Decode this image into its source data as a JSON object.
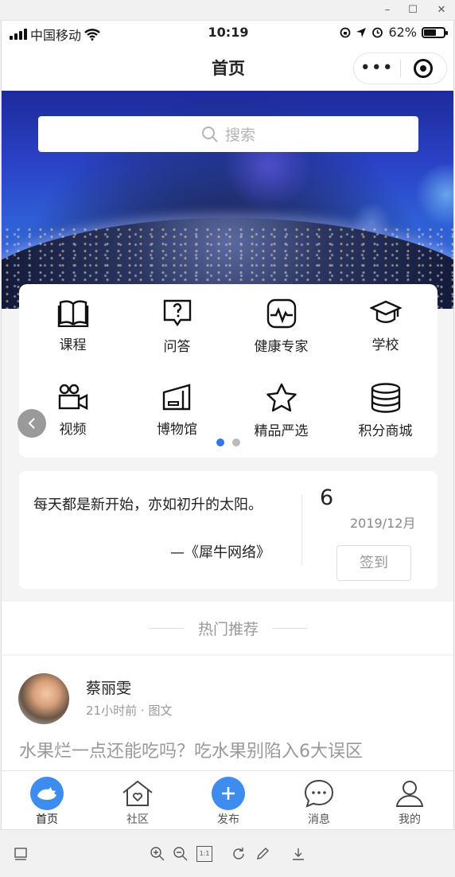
{
  "window": {
    "minimize": "–",
    "maximize": "☐",
    "close": "✕"
  },
  "status": {
    "carrier": "中国移动",
    "time": "10:19",
    "battery_pct": "62%",
    "battery_level": 0.62
  },
  "navbar": {
    "title": "首页"
  },
  "search": {
    "placeholder": "搜索"
  },
  "grid": [
    {
      "label": "课程",
      "icon": "book-icon"
    },
    {
      "label": "问答",
      "icon": "question-icon"
    },
    {
      "label": "健康专家",
      "icon": "health-icon"
    },
    {
      "label": "学校",
      "icon": "graduation-cap-icon"
    },
    {
      "label": "视频",
      "icon": "video-camera-icon"
    },
    {
      "label": "博物馆",
      "icon": "museum-icon"
    },
    {
      "label": "精品严选",
      "icon": "star-icon"
    },
    {
      "label": "积分商城",
      "icon": "coins-icon"
    }
  ],
  "carousel": {
    "pages": 2,
    "active": 0
  },
  "signin": {
    "quote": "每天都是新开始，亦如初升的太阳。",
    "source": "—《犀牛网络》",
    "day": "6",
    "year_month": "2019/12月",
    "button": "签到"
  },
  "recommend": {
    "heading": "热门推荐"
  },
  "post": {
    "author": "蔡丽雯",
    "time": "21小时前",
    "dot": "·",
    "kind": "图文",
    "title": "水果烂一点还能吃吗？吃水果别陷入6大误区"
  },
  "tabs": [
    {
      "label": "首页",
      "icon": "rhino-icon",
      "active": true
    },
    {
      "label": "社区",
      "icon": "house-heart-icon"
    },
    {
      "label": "发布",
      "icon": "plus-icon"
    },
    {
      "label": "消息",
      "icon": "chat-icon"
    },
    {
      "label": "我的",
      "icon": "user-icon"
    }
  ],
  "viewer_tools": {
    "actual_size": "1:1"
  },
  "colors": {
    "accent": "#3f8cf0",
    "indicator": "#3277e4"
  }
}
